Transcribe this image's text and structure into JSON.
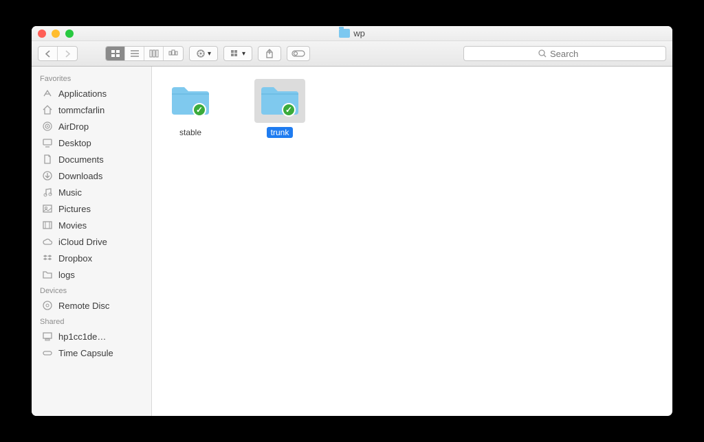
{
  "window": {
    "title": "wp"
  },
  "search": {
    "placeholder": "Search"
  },
  "sidebar": {
    "favorites_header": "Favorites",
    "devices_header": "Devices",
    "shared_header": "Shared",
    "favorites": [
      {
        "label": "Applications",
        "icon": "app-icon"
      },
      {
        "label": "tommcfarlin",
        "icon": "home-icon"
      },
      {
        "label": "AirDrop",
        "icon": "airdrop-icon"
      },
      {
        "label": "Desktop",
        "icon": "desktop-icon"
      },
      {
        "label": "Documents",
        "icon": "documents-icon"
      },
      {
        "label": "Downloads",
        "icon": "downloads-icon"
      },
      {
        "label": "Music",
        "icon": "music-icon"
      },
      {
        "label": "Pictures",
        "icon": "pictures-icon"
      },
      {
        "label": "Movies",
        "icon": "movies-icon"
      },
      {
        "label": "iCloud Drive",
        "icon": "cloud-icon"
      },
      {
        "label": "Dropbox",
        "icon": "dropbox-icon"
      },
      {
        "label": "logs",
        "icon": "folder-icon"
      }
    ],
    "devices": [
      {
        "label": "Remote Disc",
        "icon": "disc-icon"
      }
    ],
    "shared": [
      {
        "label": "hp1cc1de…",
        "icon": "computer-icon"
      },
      {
        "label": "Time Capsule",
        "icon": "capsule-icon"
      }
    ]
  },
  "items": [
    {
      "name": "stable",
      "selected": false,
      "badge": "synced"
    },
    {
      "name": "trunk",
      "selected": true,
      "badge": "synced"
    }
  ]
}
